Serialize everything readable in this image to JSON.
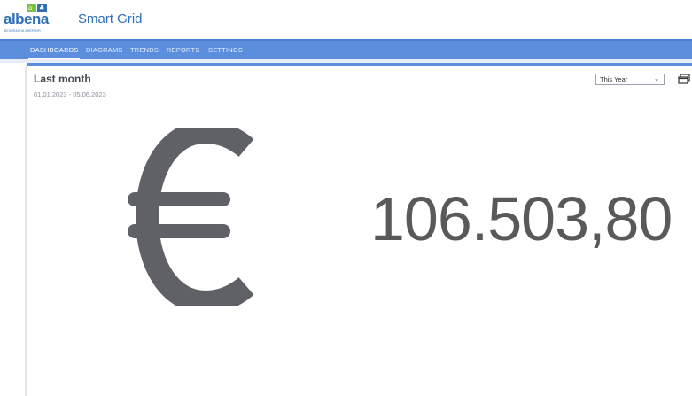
{
  "header": {
    "logo_text": "albena",
    "logo_tagline": "БЕЗОПАСНА ЕНЕРГИЯ",
    "app_title": "Smart Grid"
  },
  "nav": {
    "items": [
      {
        "label": "DASHBOARDS",
        "active": true
      },
      {
        "label": "DIAGRAMS",
        "active": false
      },
      {
        "label": "TRENDS",
        "active": false
      },
      {
        "label": "REPORTS",
        "active": false
      },
      {
        "label": "SETTINGS",
        "active": false
      }
    ]
  },
  "panel": {
    "title": "Last month",
    "date_range": "01.01.2023 - 05.06.2023",
    "period_select": "This Year",
    "currency_icon": "euro-icon",
    "value": "106.503,80"
  },
  "colors": {
    "brand_blue": "#2e6fb7",
    "brand_green": "#7ac143",
    "nav_bg": "#5b8fdd",
    "value_text": "#58595b"
  }
}
